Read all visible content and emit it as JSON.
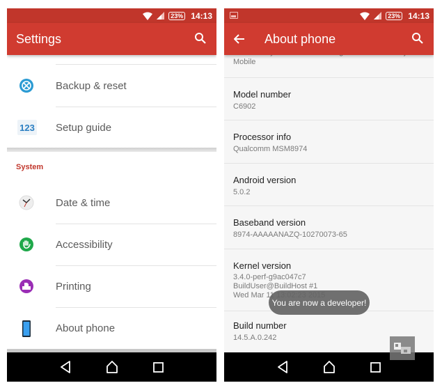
{
  "status_bar": {
    "time": "14:13",
    "battery": "23%",
    "icons": [
      "wifi-icon",
      "signal-icon",
      "battery-icon"
    ]
  },
  "left_screen": {
    "title": "Settings",
    "search_icon": "search-icon",
    "items_top": [
      {
        "label": "Backup & reset",
        "icon": "backup-reset-icon",
        "icon_color": "#2b9bd3"
      },
      {
        "label": "Setup guide",
        "icon": "setup-guide-icon",
        "icon_text": "123",
        "icon_color": "#2b7fc2"
      }
    ],
    "section_title": "System",
    "items_system": [
      {
        "label": "Date & time",
        "icon": "clock-icon"
      },
      {
        "label": "Accessibility",
        "icon": "accessibility-icon",
        "icon_color": "#1fa84a"
      },
      {
        "label": "Printing",
        "icon": "printing-icon",
        "icon_color": "#9a2eb5"
      },
      {
        "label": "About phone",
        "icon": "phone-icon",
        "icon_color": "#3aa0f0"
      }
    ]
  },
  "right_screen": {
    "title": "About phone",
    "back_icon": "back-arrow-icon",
    "search_icon": "search-icon",
    "clipped_item_text": "Send anonymous data and usage statistics to Sony",
    "clipped_item_text2": "Mobile",
    "items": [
      {
        "title": "Model number",
        "value": "C6902"
      },
      {
        "title": "Processor info",
        "value": "Qualcomm MSM8974"
      },
      {
        "title": "Android version",
        "value": "5.0.2"
      },
      {
        "title": "Baseband version",
        "value": "8974-AAAAANAZQ-10270073-65"
      },
      {
        "title": "Kernel version",
        "value": "3.4.0-perf-g9ac047c7",
        "value2": "BuildUser@BuildHost #1",
        "value3": "Wed Mar 11 13:02:23 2015"
      },
      {
        "title": "Build number",
        "value": "14.5.A.0.242"
      }
    ],
    "toast": "You are now a developer!"
  },
  "nav_bar": {
    "back": "back-triangle-icon",
    "home": "home-icon",
    "recents": "recents-icon"
  },
  "colors": {
    "toolbar": "#d03b30",
    "status_bar": "#c1362b",
    "accent": "#c1362b"
  }
}
